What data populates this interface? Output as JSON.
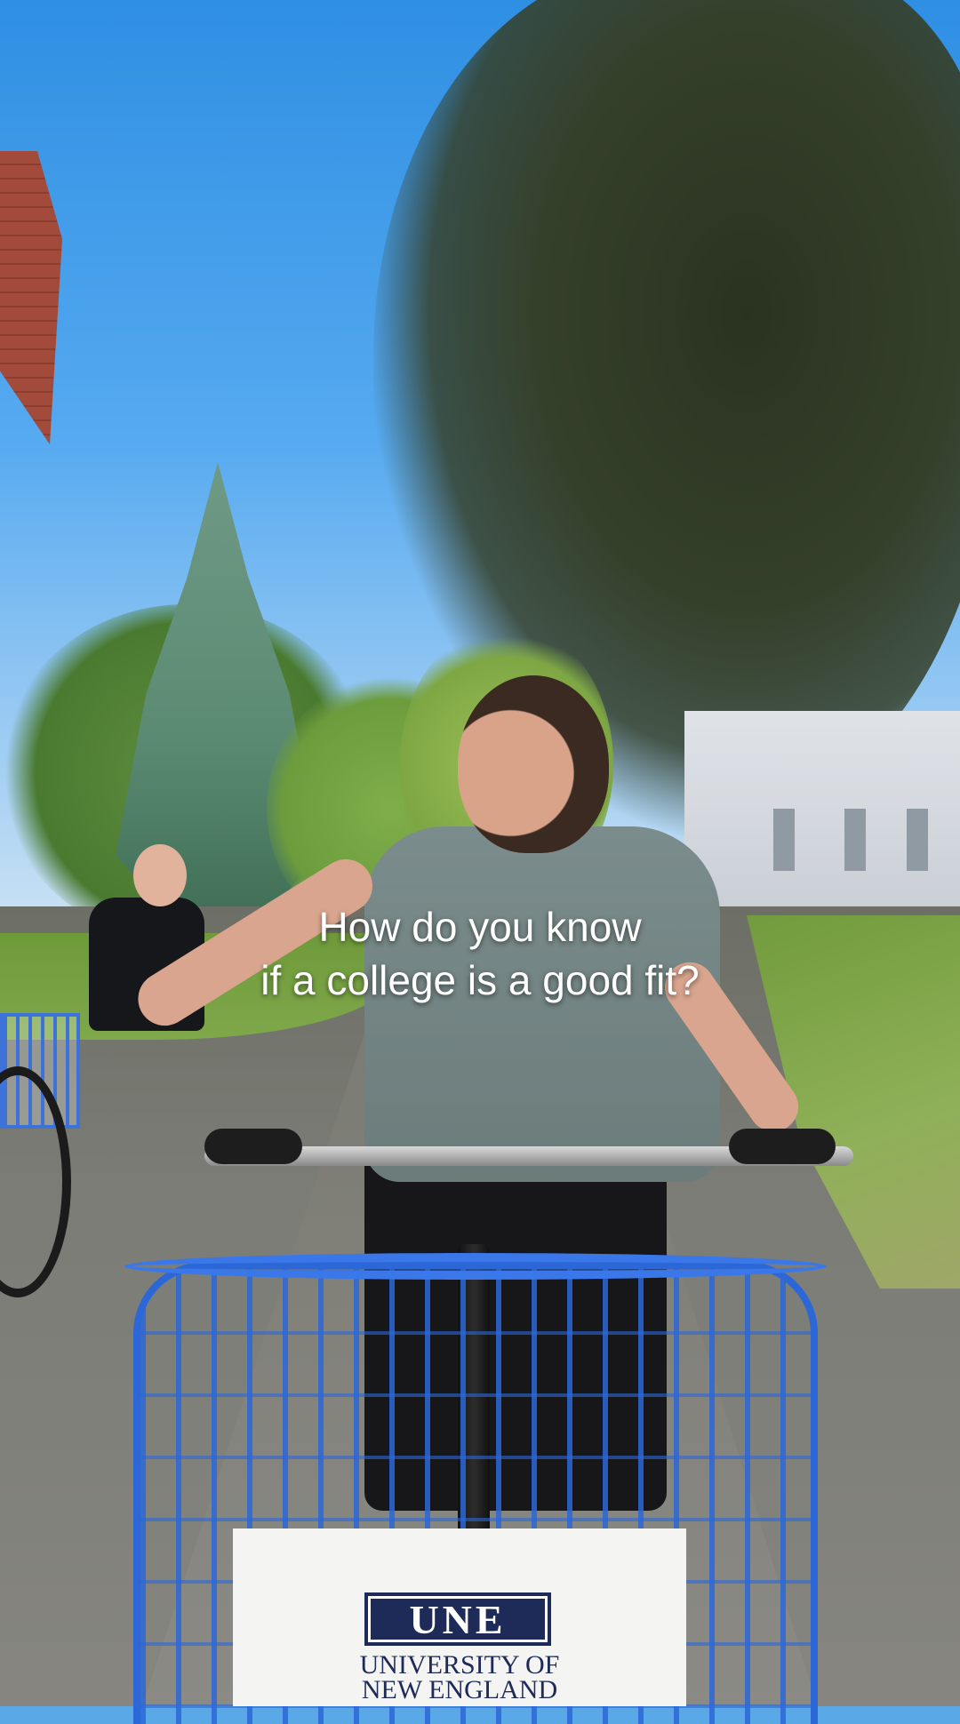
{
  "caption": {
    "line1": "How do you know",
    "line2": "if a college is a good fit?"
  },
  "basket_sign": {
    "logo": "UNE",
    "name_line1": "UNIVERSITY OF",
    "name_line2": "NEW ENGLAND"
  },
  "colors": {
    "sky": "#2f8fe3",
    "basket": "#2c67d8",
    "caption_text": "#ffffff",
    "logo_navy": "#1e2a57"
  }
}
